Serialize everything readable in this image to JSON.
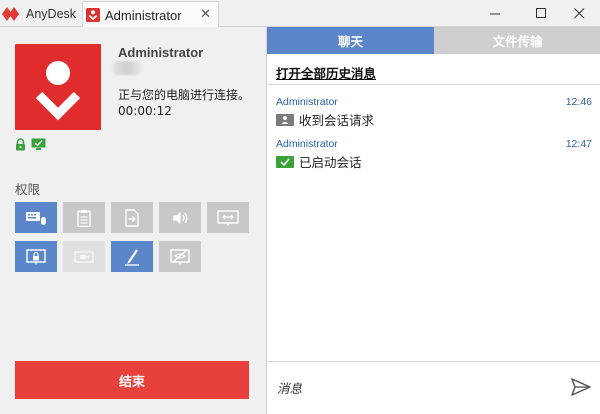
{
  "app": {
    "brand_name": "AnyDesk"
  },
  "tab": {
    "title": "Administrator",
    "close_glyph": "✕"
  },
  "window_controls": {
    "minimize": "—",
    "maximize": "☐",
    "close": "✕"
  },
  "session": {
    "user_name": "Administrator",
    "status": "正与您的电脑进行连接。",
    "elapsed": "00:00:12"
  },
  "permissions": {
    "title": "权限",
    "items": [
      {
        "icon": "keyboard-mouse-icon",
        "state": "on"
      },
      {
        "icon": "clipboard-icon",
        "state": "off"
      },
      {
        "icon": "file-transfer-icon",
        "state": "off"
      },
      {
        "icon": "sound-icon",
        "state": "off"
      },
      {
        "icon": "screen-control-icon",
        "state": "off"
      },
      {
        "icon": "lock-screen-icon",
        "state": "on"
      },
      {
        "icon": "record-icon",
        "state": "disabled"
      },
      {
        "icon": "draw-pen-icon",
        "state": "on"
      },
      {
        "icon": "privacy-screen-icon",
        "state": "off"
      }
    ]
  },
  "end_button": {
    "label": "结束"
  },
  "chat": {
    "tabs": [
      {
        "label": "聊天",
        "active": true
      },
      {
        "label": "文件传输",
        "active": false
      }
    ],
    "history_link": "打开全部历史消息",
    "messages": [
      {
        "sender": "Administrator",
        "time": "12:46",
        "text": "收到会话请求",
        "icon": "session-request-icon"
      },
      {
        "sender": "Administrator",
        "time": "12:47",
        "text": "已启动会话",
        "icon": "session-started-icon"
      }
    ],
    "input_placeholder": "消息"
  },
  "colors": {
    "brand_red": "#e02c2c",
    "accent_blue": "#5b86c9",
    "end_red": "#e8403a",
    "sender_blue": "#2b5fa5"
  }
}
